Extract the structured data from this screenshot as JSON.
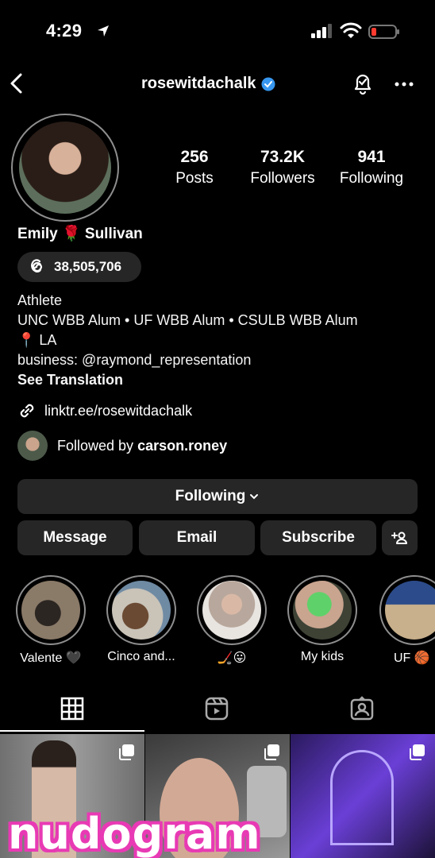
{
  "status_bar": {
    "time": "4:29"
  },
  "header": {
    "username": "rosewitdachalk"
  },
  "stats": [
    {
      "value": "256",
      "label": "Posts"
    },
    {
      "value": "73.2K",
      "label": "Followers"
    },
    {
      "value": "941",
      "label": "Following"
    }
  ],
  "profile": {
    "full_name": "Emily 🌹 Sullivan",
    "threads_count": "38,505,706",
    "bio": [
      "Athlete",
      "UNC WBB Alum • UF WBB Alum • CSULB WBB Alum",
      "📍 LA",
      "business: @raymond_representation"
    ],
    "see_translation": "See Translation",
    "link": "linktr.ee/rosewitdachalk",
    "followed_by_prefix": "Followed by ",
    "followed_by_user": "carson.roney"
  },
  "actions": {
    "following": "Following",
    "message": "Message",
    "email": "Email",
    "subscribe": "Subscribe"
  },
  "highlights": [
    {
      "label": "Valente 🖤",
      "color": "#8a7a68"
    },
    {
      "label": "Cinco and...",
      "color": "#9b8f80"
    },
    {
      "label": "🏒😛",
      "color": "#b29b90"
    },
    {
      "label": "My kids",
      "color": "#5f6a55"
    },
    {
      "label": "UF 🏀",
      "color": "#7f8fa8"
    }
  ],
  "tabs": [
    "grid-icon",
    "reels-icon",
    "tagged-icon"
  ],
  "watermark": "nudogram",
  "colors": {
    "accent": "#3897f0",
    "watermark": "#e83ab4",
    "button_bg": "#262626"
  }
}
